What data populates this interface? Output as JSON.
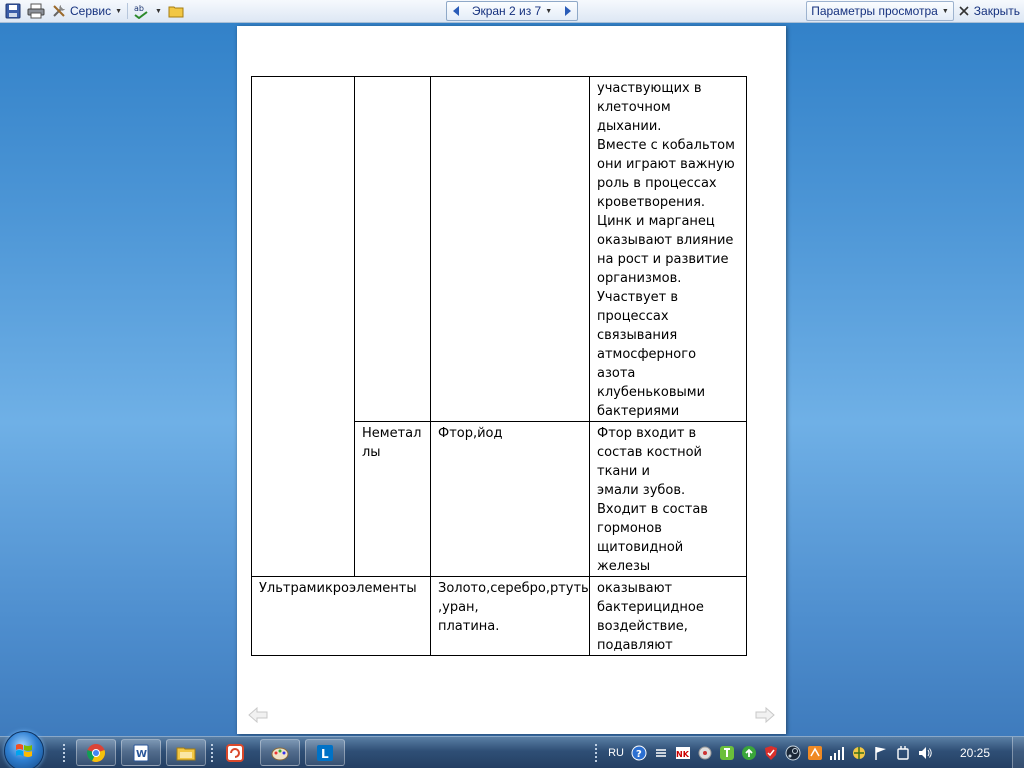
{
  "toolbar": {
    "service_label": "Сервис",
    "nav_label": "Экран 2 из 7",
    "view_options_label": "Параметры просмотра",
    "close_label": "Закрыть"
  },
  "document": {
    "rows": [
      {
        "col1": "",
        "col2": "",
        "col3": "",
        "col4": "участвующих в\nклеточном\nдыхании.\nВместе с кобальтом\nони играют важную\nроль в процессах\nкроветворения.\nЦинк и марганец\nоказывают влияние\nна рост и развитие\nорганизмов.\nУчаствует в\nпроцессах\nсвязывания\nатмосферного\n азота\nклубеньковыми\nбактериями"
      },
      {
        "col2": "Неметал\nлы",
        "col3": "Фтор,йод",
        "col4": "Фтор входит в\nсостав костной\nткани и\n эмали зубов.\nВходит в состав\nгормонов\nщитовидной\nжелезы"
      },
      {
        "col1": "Ультрамикроэлементы",
        "col3": "Золото,серебро,ртуть\n,уран,\nплатина.",
        "col4": "оказывают\nбактерицидное\nвоздействие,\nподавляют"
      }
    ]
  },
  "taskbar": {
    "language": "RU",
    "time": "20:25"
  },
  "colors": {
    "accent_text": "#15317e",
    "desktop": "#4d96d6"
  }
}
